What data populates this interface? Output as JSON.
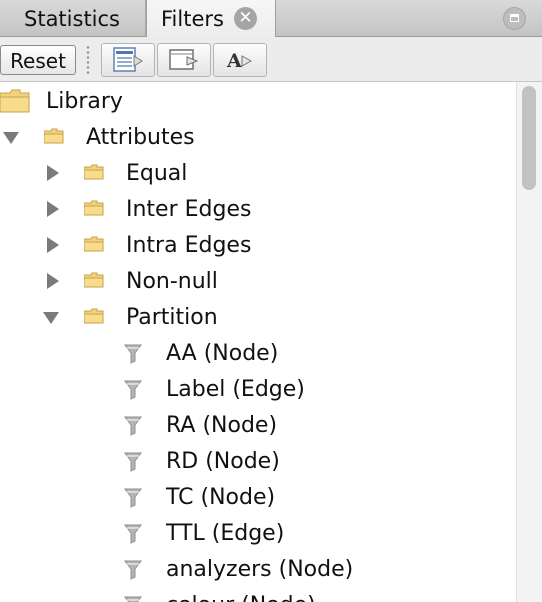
{
  "tabs": [
    {
      "label": "Statistics",
      "active": false
    },
    {
      "label": "Filters",
      "active": true,
      "close_glyph": "✕"
    }
  ],
  "toolbar": {
    "reset_label": "Reset",
    "icons": [
      "filter-list-icon",
      "export-icon",
      "rename-icon"
    ],
    "rename_glyph": "A"
  },
  "tree": {
    "root": {
      "label": "Library",
      "icon": "folder-icon"
    },
    "attributes": {
      "label": "Attributes",
      "expanded": true
    },
    "categories": [
      {
        "label": "Equal",
        "expanded": false
      },
      {
        "label": "Inter Edges",
        "expanded": false
      },
      {
        "label": "Intra Edges",
        "expanded": false
      },
      {
        "label": "Non-null",
        "expanded": false
      },
      {
        "label": "Partition",
        "expanded": true
      }
    ],
    "partition_items": [
      "AA (Node)",
      "Label (Edge)",
      "RA (Node)",
      "RD (Node)",
      "TC (Node)",
      "TTL (Edge)",
      "analyzers (Node)",
      "colour (Node)"
    ]
  },
  "colors": {
    "folder": "#f3d27a",
    "folder_edge": "#c9a24a",
    "arrow": "#7a7a7a",
    "filter_icon": "#8e8e8e"
  }
}
